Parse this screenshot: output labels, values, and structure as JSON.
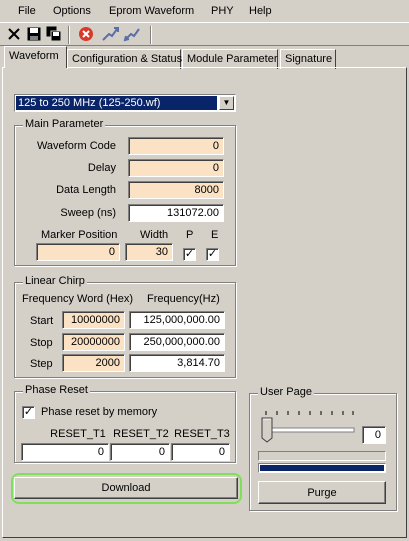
{
  "menu": {
    "file": "File",
    "options": "Options",
    "eprom": "Eprom Waveform",
    "phy": "PHY",
    "help": "Help"
  },
  "toolbar": {
    "icons": [
      "close-icon",
      "save-icon",
      "save-all-icon",
      "stop-icon",
      "upload-icon",
      "download-icon"
    ]
  },
  "tabs": [
    "Waveform",
    "Configuration & Status",
    "Module Parameter",
    "Signature"
  ],
  "waveform": {
    "selected": "125 to 250 MHz (125-250.wf)",
    "main_parameter": {
      "title": "Main Parameter",
      "waveform_code_label": "Waveform Code",
      "waveform_code": "0",
      "delay_label": "Delay",
      "delay": "0",
      "data_length_label": "Data Length",
      "data_length": "8000",
      "sweep_label": "Sweep (ns)",
      "sweep": "131072.00",
      "marker_position_label": "Marker Position",
      "marker_position": "0",
      "width_label": "Width",
      "width": "30",
      "p_label": "P",
      "e_label": "E",
      "p_checked": "✓",
      "e_checked": "✓"
    },
    "linear_chirp": {
      "title": "Linear Chirp",
      "freq_word_label": "Frequency Word (Hex)",
      "freq_hz_label": "Frequency(Hz)",
      "start_label": "Start",
      "stop_label": "Stop",
      "step_label": "Step",
      "start_word": "10000000",
      "stop_word": "20000000",
      "step_word": "2000",
      "start_hz": "125,000,000.00",
      "stop_hz": "250,000,000.00",
      "step_hz": "3,814.70"
    },
    "phase_reset": {
      "title": "Phase Reset",
      "by_memory_label": "Phase reset by memory",
      "by_memory_checked": "✓",
      "t1_label": "RESET_T1",
      "t2_label": "RESET_T2",
      "t3_label": "RESET_T3",
      "t1": "0",
      "t2": "0",
      "t3": "0"
    },
    "download_label": "Download",
    "user_page": {
      "title": "User Page",
      "value": "0",
      "slider_level": 0,
      "purge_label": "Purge"
    }
  },
  "colors": {
    "window_bg": "#d4d0c8",
    "field_bg": "#fbe2c4",
    "selection_bg": "#0a246a",
    "progress_bar": "#0a246a",
    "highlight_ring": "#7ee05a"
  }
}
